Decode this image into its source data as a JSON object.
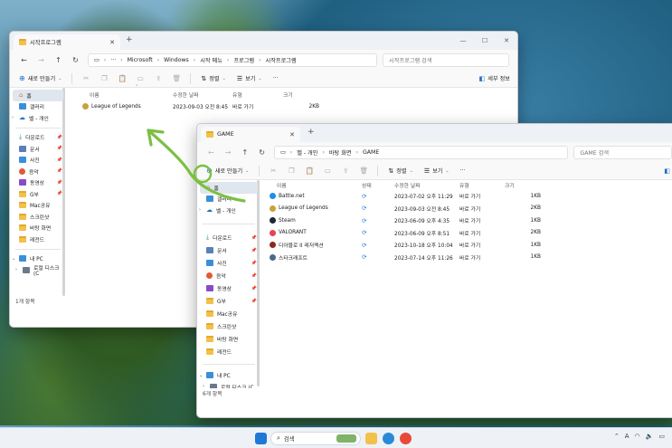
{
  "windowA": {
    "tab_title": "시작프로그램",
    "breadcrumb": [
      "Microsoft",
      "Windows",
      "시작 메뉴",
      "프로그램",
      "시작프로그램"
    ],
    "search_placeholder": "시작프로그램 검색",
    "new_label": "새로 만들기",
    "sort_label": "정렬",
    "view_label": "보기",
    "more_label": "···",
    "details_label": "세부 정보",
    "columns": {
      "name": "이름",
      "modified": "수정한 날짜",
      "type": "유형",
      "size": "크기"
    },
    "files": [
      {
        "name": "League of Legends",
        "modified": "2023-09-03 오전 8:45",
        "type": "바로 가기",
        "size": "2KB"
      }
    ],
    "sidebar": [
      {
        "label": "홈",
        "icon": "home-icon"
      },
      {
        "label": "갤러리",
        "icon": "gallery-icon"
      },
      {
        "label": "벨 - 개인",
        "icon": "onedrive-icon"
      },
      {
        "label": "다운로드",
        "icon": "download-icon"
      },
      {
        "label": "문서",
        "icon": "documents-icon"
      },
      {
        "label": "사진",
        "icon": "pictures-icon"
      },
      {
        "label": "음악",
        "icon": "music-icon"
      },
      {
        "label": "동영상",
        "icon": "videos-icon"
      },
      {
        "label": "G부",
        "icon": "folder-icon"
      },
      {
        "label": "Mac공유",
        "icon": "folder-icon"
      },
      {
        "label": "스크린샷",
        "icon": "folder-icon"
      },
      {
        "label": "바탕 화면",
        "icon": "folder-icon"
      },
      {
        "label": "레전드",
        "icon": "folder-icon"
      },
      {
        "label": "내 PC",
        "icon": "pc-icon"
      },
      {
        "label": "로컬 디스크 (C",
        "icon": "disk-icon"
      }
    ],
    "status": "1개 항목"
  },
  "windowB": {
    "tab_title": "GAME",
    "breadcrumb": [
      "벨 - 개인",
      "바탕 화면",
      "GAME"
    ],
    "search_placeholder": "GAME 검색",
    "new_label": "새로 만들기",
    "sort_label": "정렬",
    "view_label": "보기",
    "more_label": "···",
    "columns": {
      "name": "이름",
      "state": "상태",
      "modified": "수정한 날짜",
      "type": "유형",
      "size": "크기"
    },
    "files": [
      {
        "name": "Battle.net",
        "modified": "2023-07-02 오후 11:29",
        "type": "바로 가기",
        "size": "1KB",
        "color": "#1e8fe6"
      },
      {
        "name": "League of Legends",
        "modified": "2023-09-03 오전 8:45",
        "type": "바로 가기",
        "size": "2KB",
        "color": "#c8a23b"
      },
      {
        "name": "Steam",
        "modified": "2023-06-09 오후 4:35",
        "type": "바로 가기",
        "size": "1KB",
        "color": "#1b2838"
      },
      {
        "name": "VALORANT",
        "modified": "2023-06-09 오후 8:51",
        "type": "바로 가기",
        "size": "2KB",
        "color": "#e8434f"
      },
      {
        "name": "디아블로 II 레저렉션",
        "modified": "2023-10-18 오후 10:04",
        "type": "바로 가기",
        "size": "1KB",
        "color": "#8a2a1a"
      },
      {
        "name": "스타크래프트",
        "modified": "2023-07-14 오후 11:26",
        "type": "바로 가기",
        "size": "1KB",
        "color": "#4b6a8a"
      }
    ],
    "sidebar": [
      {
        "label": "홈",
        "icon": "home-icon"
      },
      {
        "label": "갤러리",
        "icon": "gallery-icon"
      },
      {
        "label": "벨 - 개인",
        "icon": "onedrive-icon"
      },
      {
        "label": "다운로드",
        "icon": "download-icon"
      },
      {
        "label": "문서",
        "icon": "documents-icon"
      },
      {
        "label": "사진",
        "icon": "pictures-icon"
      },
      {
        "label": "음악",
        "icon": "music-icon"
      },
      {
        "label": "동영상",
        "icon": "videos-icon"
      },
      {
        "label": "G부",
        "icon": "folder-icon"
      },
      {
        "label": "Mac공유",
        "icon": "folder-icon"
      },
      {
        "label": "스크린샷",
        "icon": "folder-icon"
      },
      {
        "label": "바탕 화면",
        "icon": "folder-icon"
      },
      {
        "label": "레전드",
        "icon": "folder-icon"
      },
      {
        "label": "내 PC",
        "icon": "pc-icon"
      },
      {
        "label": "로컬 디스크 (C",
        "icon": "disk-icon"
      }
    ],
    "status": "6개 항목"
  },
  "taskbar": {
    "search_label": "검색"
  },
  "colors": {
    "accent": "#1f6fc4",
    "arrow": "#7ac043",
    "folder": "#f2c14a"
  }
}
